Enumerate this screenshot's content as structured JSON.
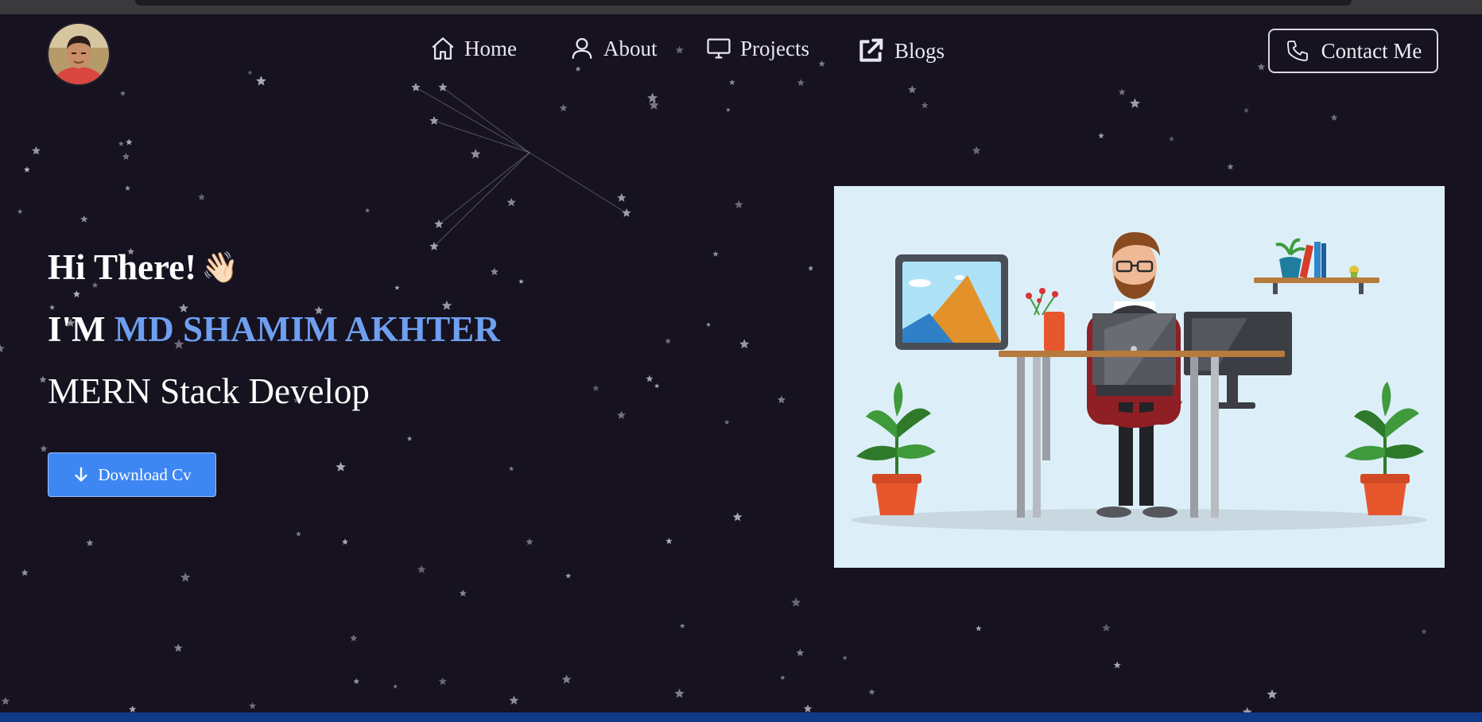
{
  "header": {
    "avatar_alt": "profile photo",
    "nav": [
      {
        "label": "Home",
        "icon": "home-icon"
      },
      {
        "label": "About",
        "icon": "user-icon"
      },
      {
        "label": "Projects",
        "icon": "monitor-icon"
      },
      {
        "label": "Blogs",
        "icon": "external-link-icon"
      }
    ],
    "contact": {
      "label": "Contact Me",
      "icon": "phone-icon"
    }
  },
  "hero": {
    "greeting": "Hi There!",
    "greeting_emoji": "👋🏻",
    "intro_prefix": "I'M",
    "name": "MD SHAMIM AKHTER",
    "role": "MERN Stack Develop",
    "download_label": "Download Cv",
    "download_icon": "arrow-down-icon"
  },
  "illustration": {
    "subject": "developer-at-desk-illustration"
  },
  "colors": {
    "background": "#16121f",
    "accent": "#6e9ff0",
    "button": "#3e86f2",
    "illustration_bg": "#dceff8"
  }
}
